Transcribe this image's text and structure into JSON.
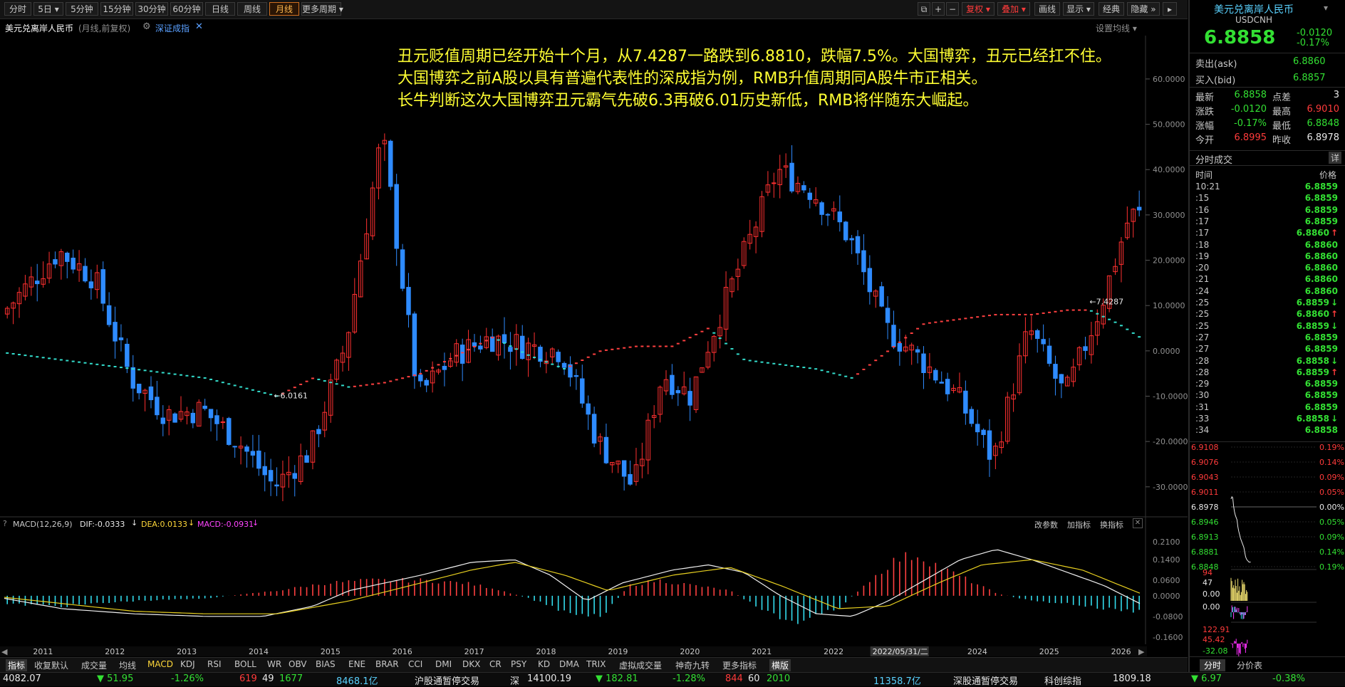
{
  "toolbar": {
    "periods": [
      "分时",
      "5日",
      "5分钟",
      "15分钟",
      "30分钟",
      "60分钟",
      "日线",
      "周线",
      "月线",
      "更多周期"
    ],
    "active_period": "月线",
    "right_buttons": [
      "复权",
      "叠加",
      "画线",
      "显示",
      "经典",
      "隐藏"
    ]
  },
  "chart_header": {
    "title": "美元兑离岸人民币",
    "mode": "(月线,前复权)",
    "index_link": "深证成指",
    "set_ma": "设置均线"
  },
  "annotation": {
    "line1": "丑元贬值周期已经开始十个月，从7.4287一路跌到6.8810，跌幅7.5%。大国博弈，丑元已经扛不住。",
    "line2": "大国博弈之前A股以具有普遍代表性的深成指为例，RMB升值周期同A股牛市正相关。",
    "line3": "长牛判断这次大国博弈丑元霸气先破6.3再破6.01历史新低，RMB将伴随东大崛起。"
  },
  "chart_data": [
    {
      "type": "candlestick",
      "title": "深证成指 月线",
      "y_axis_unit": "%",
      "yticks": [
        60.0,
        50.0,
        40.0,
        30.0,
        20.0,
        10.0,
        0.0,
        -10.0,
        -20.0,
        -30.0
      ],
      "ytick_labels": [
        "60.0000",
        "50.0000",
        "40.0000",
        "30.0000",
        "20.0000",
        "10.0000",
        "0.0000",
        "-10.0000",
        "-20.0000",
        "-30.0000"
      ],
      "ylim": [
        -36.0,
        68.0
      ],
      "x_years": [
        "2011",
        "2012",
        "2013",
        "2014",
        "2015",
        "2016",
        "2017",
        "2018",
        "2019",
        "2020",
        "2021",
        "2022",
        "2024",
        "2025",
        "2026"
      ],
      "highlight_date": "2022/05/31/二",
      "series": [
        {
          "name": "深证成指",
          "key_points": [
            [
              2010.2,
              8
            ],
            [
              2011.0,
              22
            ],
            [
              2011.5,
              16
            ],
            [
              2012.0,
              -6
            ],
            [
              2012.5,
              -14
            ],
            [
              2013.0,
              -13
            ],
            [
              2013.5,
              -20
            ],
            [
              2014.0,
              -30
            ],
            [
              2014.5,
              -22
            ],
            [
              2015.0,
              2
            ],
            [
              2015.5,
              48
            ],
            [
              2016.0,
              -10
            ],
            [
              2016.5,
              -1
            ],
            [
              2017.0,
              3
            ],
            [
              2017.5,
              1
            ],
            [
              2018.0,
              0
            ],
            [
              2018.5,
              -20
            ],
            [
              2019.0,
              -30
            ],
            [
              2019.4,
              -5
            ],
            [
              2019.8,
              -10
            ],
            [
              2020.0,
              0
            ],
            [
              2020.5,
              20
            ],
            [
              2021.0,
              40
            ],
            [
              2021.5,
              35
            ],
            [
              2022.0,
              25
            ],
            [
              2022.5,
              5
            ],
            [
              2023.0,
              -2
            ],
            [
              2023.5,
              -10
            ],
            [
              2024.0,
              -24
            ],
            [
              2024.5,
              5
            ],
            [
              2025.0,
              -10
            ],
            [
              2025.5,
              10
            ],
            [
              2025.9,
              30
            ]
          ]
        },
        {
          "name": "美元兑离岸人民币",
          "key_points": [
            [
              2010.0,
              0
            ],
            [
              2011.0,
              -2
            ],
            [
              2012.0,
              -4
            ],
            [
              2013.0,
              -6
            ],
            [
              2014.0,
              -10
            ],
            [
              2014.5,
              -6
            ],
            [
              2015.0,
              -8
            ],
            [
              2015.5,
              -7
            ],
            [
              2016.0,
              -5
            ],
            [
              2016.5,
              -1
            ],
            [
              2017.0,
              3
            ],
            [
              2017.5,
              -1
            ],
            [
              2018.0,
              -4
            ],
            [
              2018.5,
              0
            ],
            [
              2019.0,
              1
            ],
            [
              2019.5,
              1
            ],
            [
              2020.0,
              5
            ],
            [
              2020.5,
              -2
            ],
            [
              2021.0,
              -3
            ],
            [
              2021.5,
              -4
            ],
            [
              2022.0,
              -6
            ],
            [
              2022.5,
              0
            ],
            [
              2023.0,
              6
            ],
            [
              2023.5,
              7
            ],
            [
              2024.0,
              8
            ],
            [
              2024.5,
              8
            ],
            [
              2025.0,
              9
            ],
            [
              2025.3,
              9
            ],
            [
              2025.7,
              6
            ],
            [
              2026.0,
              3
            ]
          ]
        }
      ],
      "annotations": [
        {
          "label": "6.0161"
        },
        {
          "label": "7.4287"
        }
      ]
    },
    {
      "type": "bar",
      "title": "MACD(12,26,9)",
      "yticks": [
        0.21,
        0.14,
        0.06,
        0.0,
        -0.08,
        -0.16
      ],
      "ytick_labels": [
        "0.2100",
        "0.1400",
        "0.0600",
        "0.0000",
        "-0.0800",
        "-0.1600"
      ],
      "ylim": [
        -0.18,
        0.24
      ],
      "series": [
        {
          "name": "DIF",
          "key_points": [
            [
              2010.0,
              0
            ],
            [
              2011.0,
              -0.05
            ],
            [
              2012.0,
              -0.07
            ],
            [
              2013.0,
              -0.08
            ],
            [
              2013.8,
              -0.08
            ],
            [
              2014.5,
              -0.04
            ],
            [
              2015.0,
              0.02
            ],
            [
              2016.0,
              0.08
            ],
            [
              2016.7,
              0.13
            ],
            [
              2017.3,
              0.14
            ],
            [
              2017.8,
              0.08
            ],
            [
              2018.3,
              -0.02
            ],
            [
              2018.8,
              0.05
            ],
            [
              2019.5,
              0.1
            ],
            [
              2020.0,
              0.12
            ],
            [
              2020.5,
              0.09
            ],
            [
              2021.0,
              0.0
            ],
            [
              2021.5,
              -0.07
            ],
            [
              2022.0,
              -0.08
            ],
            [
              2022.5,
              -0.02
            ],
            [
              2023.0,
              0.06
            ],
            [
              2023.5,
              0.14
            ],
            [
              2024.0,
              0.18
            ],
            [
              2024.5,
              0.14
            ],
            [
              2025.0,
              0.09
            ],
            [
              2025.5,
              0.04
            ],
            [
              2026.0,
              -0.03
            ]
          ]
        },
        {
          "name": "DEA",
          "key_points": [
            [
              2010.0,
              0
            ],
            [
              2011.0,
              -0.03
            ],
            [
              2012.0,
              -0.06
            ],
            [
              2013.0,
              -0.07
            ],
            [
              2014.0,
              -0.07
            ],
            [
              2015.0,
              -0.02
            ],
            [
              2016.0,
              0.05
            ],
            [
              2016.7,
              0.1
            ],
            [
              2017.3,
              0.13
            ],
            [
              2018.0,
              0.08
            ],
            [
              2018.6,
              0.02
            ],
            [
              2019.5,
              0.08
            ],
            [
              2020.3,
              0.11
            ],
            [
              2021.0,
              0.04
            ],
            [
              2021.8,
              -0.05
            ],
            [
              2022.5,
              -0.04
            ],
            [
              2023.2,
              0.05
            ],
            [
              2023.8,
              0.12
            ],
            [
              2024.5,
              0.14
            ],
            [
              2025.2,
              0.1
            ],
            [
              2026.0,
              0.01
            ]
          ]
        }
      ],
      "macd_bar_points": [
        [
          2010.0,
          -0.03
        ],
        [
          2011.0,
          -0.04
        ],
        [
          2012.0,
          -0.02
        ],
        [
          2013.0,
          -0.01
        ],
        [
          2014.0,
          0.02
        ],
        [
          2014.7,
          0.05
        ],
        [
          2015.3,
          0.06
        ],
        [
          2016.0,
          0.06
        ],
        [
          2016.6,
          0.05
        ],
        [
          2017.0,
          0.03
        ],
        [
          2017.5,
          -0.01
        ],
        [
          2018.0,
          -0.06
        ],
        [
          2018.5,
          -0.08
        ],
        [
          2018.9,
          0.04
        ],
        [
          2019.3,
          0.06
        ],
        [
          2019.8,
          0.04
        ],
        [
          2020.3,
          0.02
        ],
        [
          2020.6,
          -0.03
        ],
        [
          2021.0,
          -0.09
        ],
        [
          2021.3,
          -0.1
        ],
        [
          2021.8,
          -0.05
        ],
        [
          2022.2,
          0.05
        ],
        [
          2022.6,
          0.14
        ],
        [
          2022.9,
          0.16
        ],
        [
          2023.3,
          0.1
        ],
        [
          2023.7,
          0.05
        ],
        [
          2024.0,
          0.01
        ],
        [
          2024.5,
          -0.02
        ],
        [
          2025.0,
          -0.03
        ],
        [
          2025.5,
          -0.05
        ],
        [
          2026.0,
          -0.06
        ]
      ]
    },
    {
      "type": "line",
      "title": "分时",
      "yticks_left": [
        "6.9108",
        "6.9076",
        "6.9043",
        "6.9011",
        "6.8978",
        "6.8946",
        "6.8913",
        "6.8881",
        "6.8848"
      ],
      "yticks_right": [
        "0.19%",
        "0.14%",
        "0.09%",
        "0.05%",
        "0.00%",
        "0.05%",
        "0.09%",
        "0.14%",
        "0.19%"
      ],
      "ref_price": 6.8978,
      "x": [
        0,
        1,
        2,
        3,
        4,
        5,
        6,
        7,
        8,
        9,
        10,
        11,
        12,
        13,
        14,
        15,
        16,
        17,
        18,
        19,
        20,
        21,
        22,
        23
      ],
      "y": [
        6.8995,
        6.9,
        6.8998,
        6.898,
        6.8968,
        6.896,
        6.8955,
        6.895,
        6.8935,
        6.8925,
        6.8918,
        6.891,
        6.8905,
        6.89,
        6.8895,
        6.889,
        6.888,
        6.887,
        6.8865,
        6.8862,
        6.886,
        6.8858,
        6.8858,
        6.8858
      ],
      "lower_labels": [
        "94",
        "47",
        "0.00",
        "0.00",
        "122.91",
        "45.42",
        "-32.08"
      ]
    }
  ],
  "macd_header": {
    "name": "MACD(12,26,9)",
    "dif": "DIF:-0.0333",
    "dea": "DEA:0.0133",
    "macd": "MACD:-0.0931",
    "buttons": [
      "改参数",
      "加指标",
      "换指标"
    ]
  },
  "bottom_tabs": [
    "指标",
    "收复默认",
    "成交量",
    "均线",
    "MACD",
    "KDJ",
    "RSI",
    "BOLL",
    "WR",
    "OBV",
    "BIAS",
    "ENE",
    "BRAR",
    "CCI",
    "DMI",
    "DKX",
    "CR",
    "PSY",
    "KD",
    "DMA",
    "TRIX",
    "虚拟成交量",
    "神奇九转",
    "更多指标",
    "横版"
  ],
  "right_panel": {
    "title": "美元兑离岸人民币",
    "code": "USDCNH",
    "price": "6.8858",
    "change": "-0.0120",
    "change_pct": "-0.17%",
    "ask_label": "卖出(ask)",
    "ask": "6.8860",
    "bid_label": "买入(bid)",
    "bid": "6.8857",
    "stats": [
      {
        "l1": "最新",
        "v1": "6.8858",
        "c1": "g",
        "l2": "点差",
        "v2": "3",
        "c2": "w"
      },
      {
        "l1": "涨跌",
        "v1": "-0.0120",
        "c1": "g",
        "l2": "最高",
        "v2": "6.9010",
        "c2": "r"
      },
      {
        "l1": "涨幅",
        "v1": "-0.17%",
        "c1": "g",
        "l2": "最低",
        "v2": "6.8848",
        "c2": "g"
      },
      {
        "l1": "今开",
        "v1": "6.8995",
        "c1": "r",
        "l2": "昨收",
        "v2": "6.8978",
        "c2": "w"
      }
    ],
    "trades_title": "分时成交",
    "detail_btn": "详",
    "col_time": "时间",
    "col_price": "价格",
    "ticks": [
      {
        "t": "10:21",
        "p": "6.8859",
        "a": ""
      },
      {
        "t": ":15",
        "p": "6.8859",
        "a": ""
      },
      {
        "t": ":16",
        "p": "6.8859",
        "a": ""
      },
      {
        "t": ":17",
        "p": "6.8859",
        "a": ""
      },
      {
        "t": ":17",
        "p": "6.8860",
        "a": "up"
      },
      {
        "t": ":18",
        "p": "6.8860",
        "a": ""
      },
      {
        "t": ":19",
        "p": "6.8860",
        "a": ""
      },
      {
        "t": ":20",
        "p": "6.8860",
        "a": ""
      },
      {
        "t": ":21",
        "p": "6.8860",
        "a": ""
      },
      {
        "t": ":24",
        "p": "6.8860",
        "a": ""
      },
      {
        "t": ":25",
        "p": "6.8859",
        "a": "dn"
      },
      {
        "t": ":25",
        "p": "6.8860",
        "a": "up"
      },
      {
        "t": ":25",
        "p": "6.8859",
        "a": "dn"
      },
      {
        "t": ":27",
        "p": "6.8859",
        "a": ""
      },
      {
        "t": ":27",
        "p": "6.8859",
        "a": ""
      },
      {
        "t": ":28",
        "p": "6.8858",
        "a": "dn"
      },
      {
        "t": ":28",
        "p": "6.8859",
        "a": "up"
      },
      {
        "t": ":29",
        "p": "6.8859",
        "a": ""
      },
      {
        "t": ":30",
        "p": "6.8859",
        "a": ""
      },
      {
        "t": ":31",
        "p": "6.8859",
        "a": ""
      },
      {
        "t": ":33",
        "p": "6.8858",
        "a": "dn"
      },
      {
        "t": ":34",
        "p": "6.8858",
        "a": ""
      }
    ],
    "bottom_tabs": [
      "分时",
      "分价表"
    ]
  },
  "status_bar": [
    {
      "text": "4082.07",
      "c": "w"
    },
    {
      "text": "▼ 51.95",
      "c": "g"
    },
    {
      "text": "-1.26%",
      "c": "g"
    },
    {
      "text": "619",
      "c": "r"
    },
    {
      "text": "49",
      "c": "w"
    },
    {
      "text": "1677",
      "c": "g"
    },
    {
      "text": "8468.1亿",
      "c": "c"
    },
    {
      "text": "沪股通暂停交易",
      "c": "w"
    },
    {
      "text": "深",
      "c": "w"
    },
    {
      "text": "14100.19",
      "c": "w"
    },
    {
      "text": "▼ 182.81",
      "c": "g"
    },
    {
      "text": "-1.28%",
      "c": "g"
    },
    {
      "text": "844",
      "c": "r"
    },
    {
      "text": "60",
      "c": "w"
    },
    {
      "text": "2010",
      "c": "g"
    },
    {
      "text": "11358.7亿",
      "c": "c"
    },
    {
      "text": "深股通暂停交易",
      "c": "w"
    },
    {
      "text": "科创综指",
      "c": "w"
    },
    {
      "text": "1809.18",
      "c": "w"
    },
    {
      "text": "▼ 6.97",
      "c": "g"
    },
    {
      "text": "-0.38%",
      "c": "g"
    }
  ]
}
